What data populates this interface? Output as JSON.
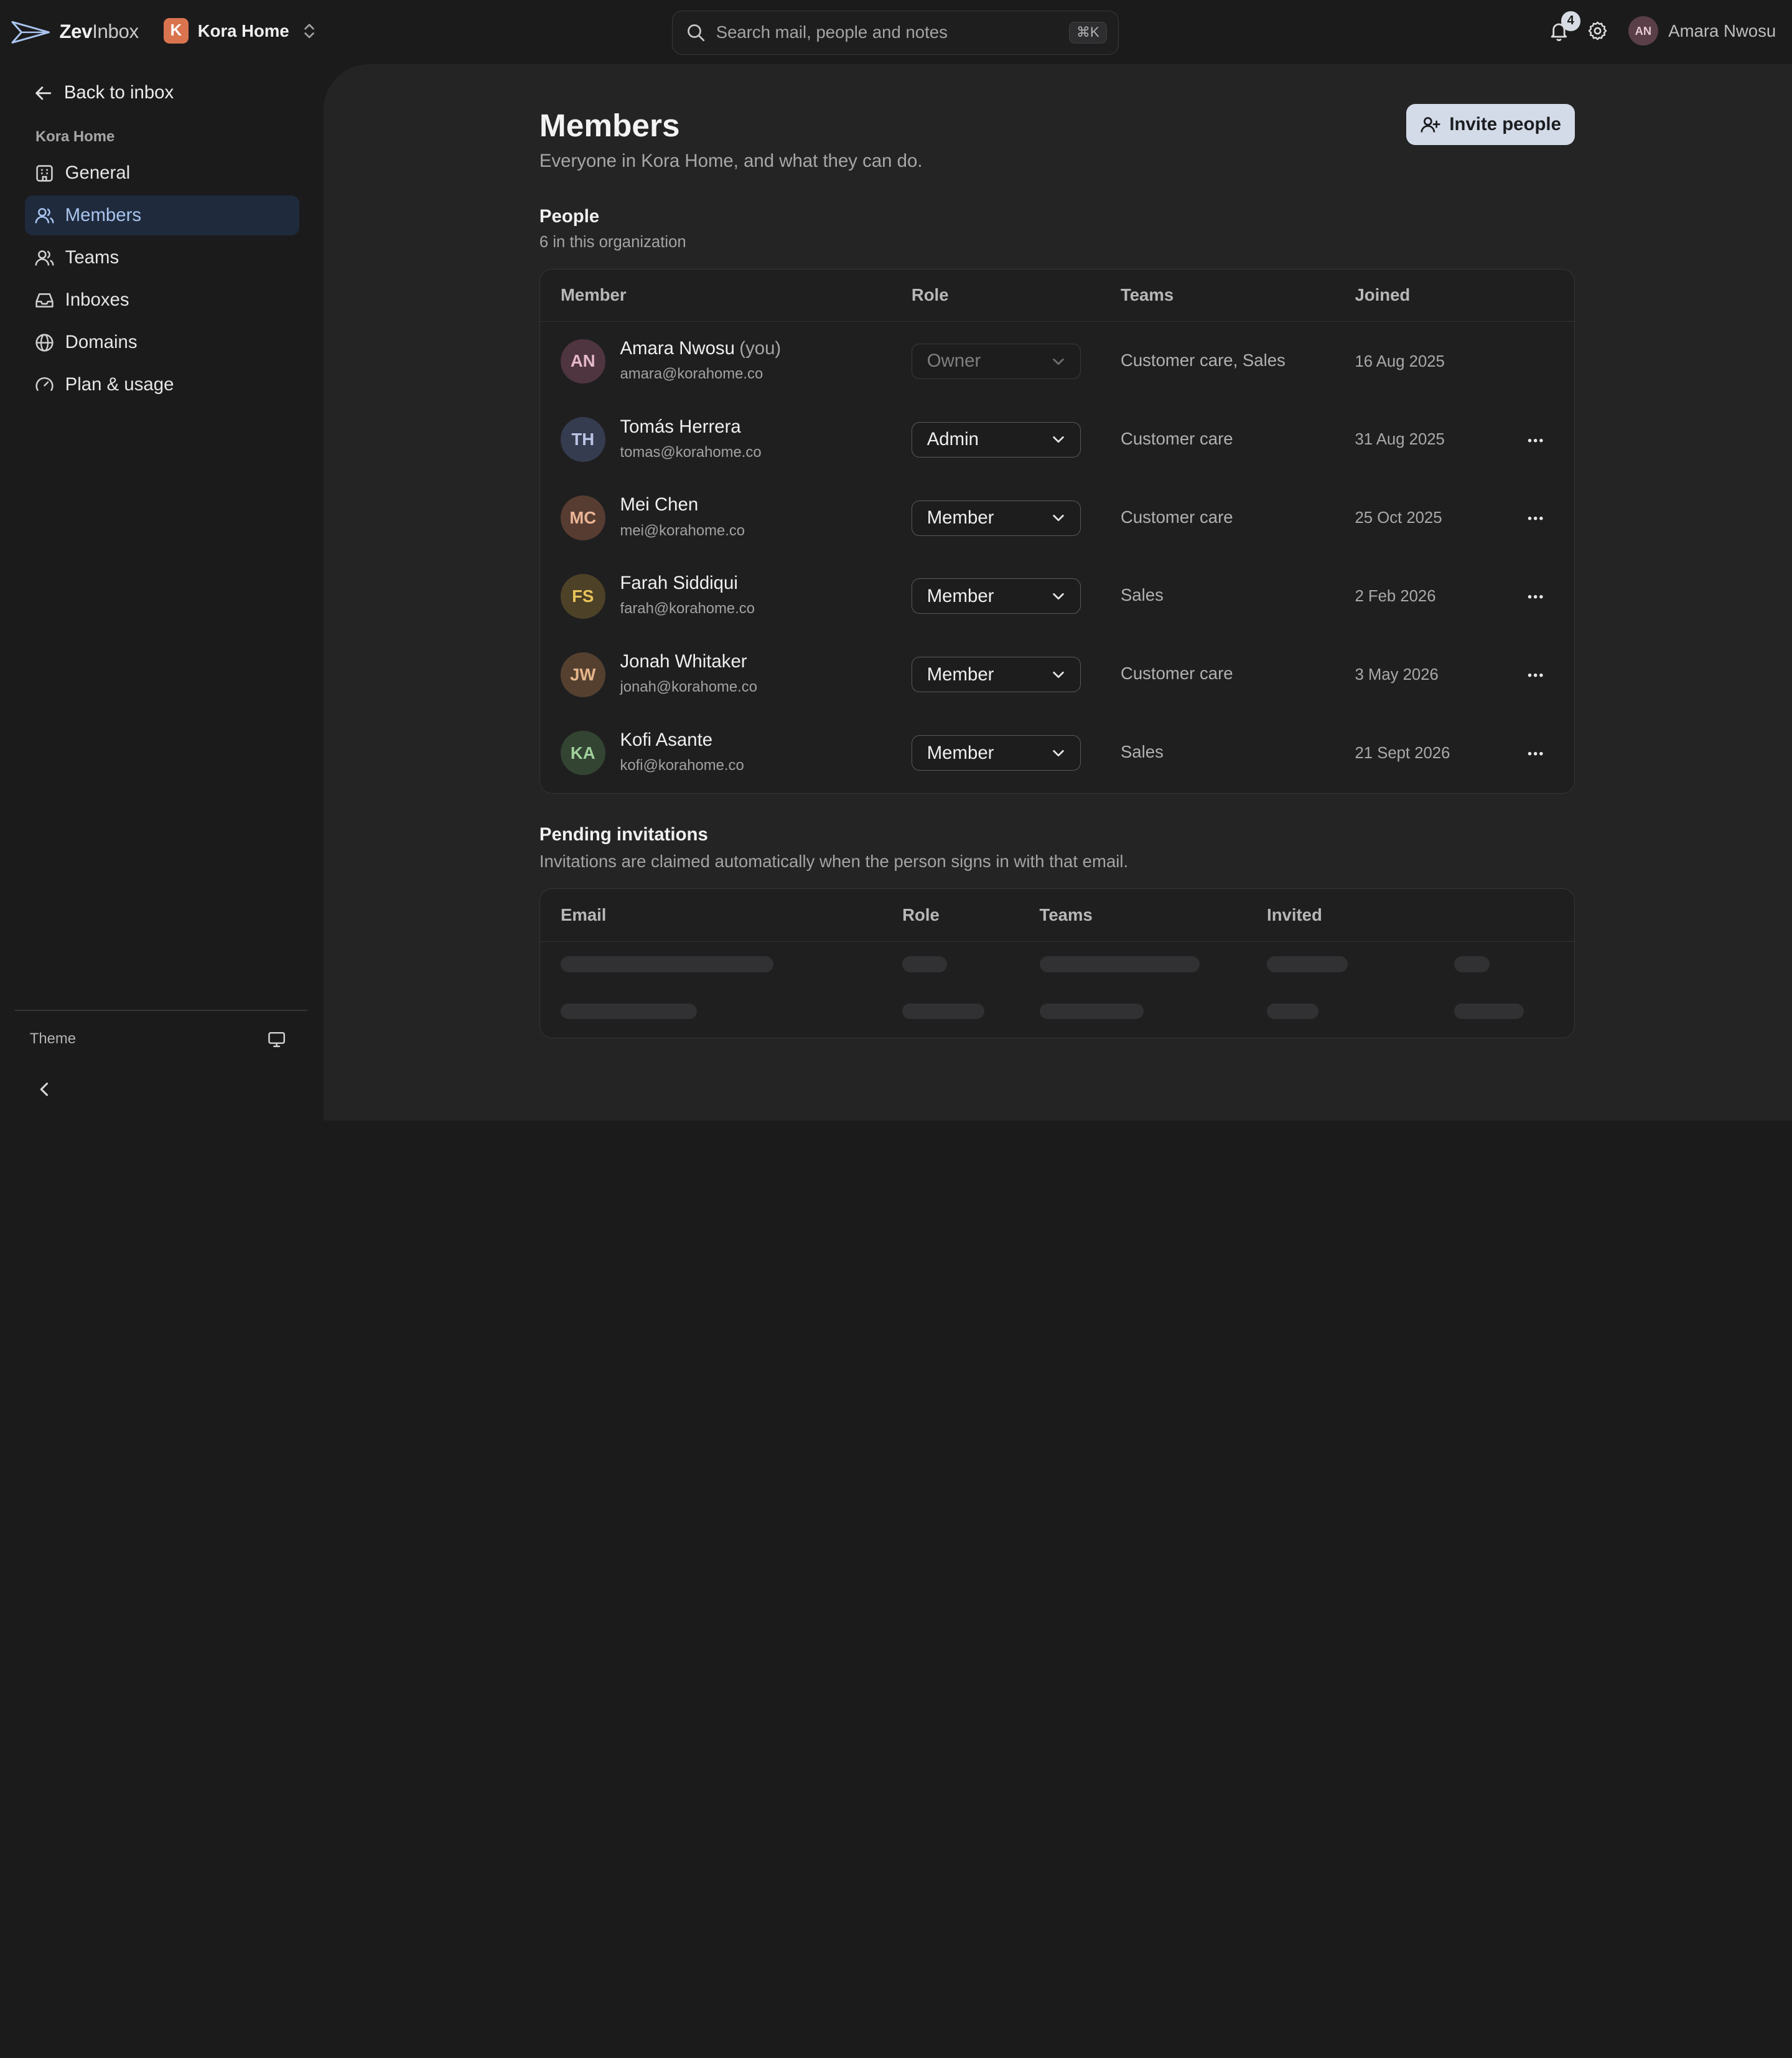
{
  "brand": {
    "name_bold": "Zev",
    "name_thin": "Inbox"
  },
  "workspace": {
    "initial": "K",
    "name": "Kora Home",
    "color": "#d9744f"
  },
  "search": {
    "placeholder": "Search mail, people and notes",
    "shortcut": "⌘K"
  },
  "notifications": {
    "count": "4"
  },
  "user": {
    "initials": "AN",
    "name": "Amara Nwosu"
  },
  "sidebar": {
    "back_label": "Back to inbox",
    "section_label": "Kora Home",
    "items": [
      {
        "label": "General",
        "icon": "building-icon"
      },
      {
        "label": "Members",
        "icon": "users-icon",
        "active": true
      },
      {
        "label": "Teams",
        "icon": "team-icon"
      },
      {
        "label": "Inboxes",
        "icon": "inbox-icon"
      },
      {
        "label": "Domains",
        "icon": "globe-icon"
      },
      {
        "label": "Plan & usage",
        "icon": "gauge-icon"
      }
    ],
    "theme_label": "Theme"
  },
  "page": {
    "title": "Members",
    "subtitle": "Everyone in Kora Home, and what they can do.",
    "invite_label": "Invite people"
  },
  "people": {
    "title": "People",
    "count_text": "6 in this organization",
    "columns": [
      "Member",
      "Role",
      "Teams",
      "Joined"
    ],
    "members": [
      {
        "initials": "AN",
        "name": "Amara Nwosu",
        "you": "(you)",
        "email": "amara@korahome.co",
        "role": "Owner",
        "role_locked": true,
        "teams": "Customer care, Sales",
        "joined": "16 Aug 2025",
        "avatar_bg": "#4f3540",
        "avatar_fg": "#e6b8c8"
      },
      {
        "initials": "TH",
        "name": "Tomás Herrera",
        "email": "tomas@korahome.co",
        "role": "Admin",
        "teams": "Customer care",
        "joined": "31 Aug 2025",
        "avatar_bg": "#363c50",
        "avatar_fg": "#b9c3e4"
      },
      {
        "initials": "MC",
        "name": "Mei Chen",
        "email": "mei@korahome.co",
        "role": "Member",
        "teams": "Customer care",
        "joined": "25 Oct 2025",
        "avatar_bg": "#573c31",
        "avatar_fg": "#eab596"
      },
      {
        "initials": "FS",
        "name": "Farah Siddiqui",
        "email": "farah@korahome.co",
        "role": "Member",
        "teams": "Sales",
        "joined": "2 Feb 2026",
        "avatar_bg": "#4d4127",
        "avatar_fg": "#e8c35a"
      },
      {
        "initials": "JW",
        "name": "Jonah Whitaker",
        "email": "jonah@korahome.co",
        "role": "Member",
        "teams": "Customer care",
        "joined": "3 May 2026",
        "avatar_bg": "#55402f",
        "avatar_fg": "#e4b58a"
      },
      {
        "initials": "KA",
        "name": "Kofi Asante",
        "email": "kofi@korahome.co",
        "role": "Member",
        "teams": "Sales",
        "joined": "21 Sept 2026",
        "avatar_bg": "#334433",
        "avatar_fg": "#9fd09a"
      }
    ]
  },
  "pending": {
    "title": "Pending invitations",
    "description": "Invitations are claimed automatically when the person signs in with that email.",
    "columns": [
      "Email",
      "Role",
      "Teams",
      "Invited"
    ]
  }
}
